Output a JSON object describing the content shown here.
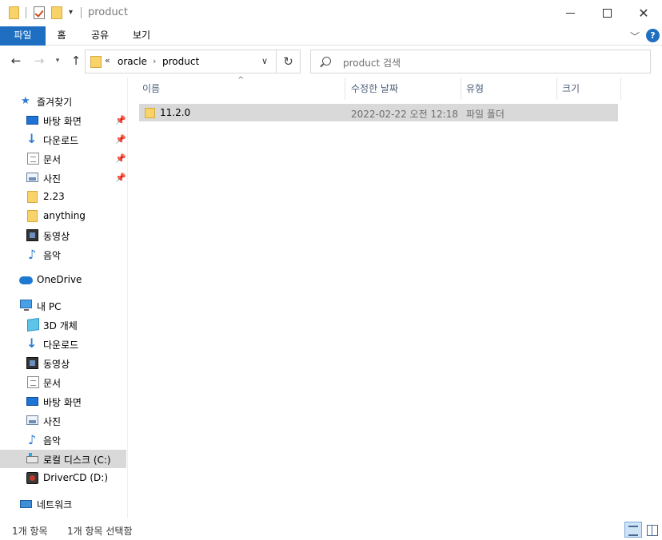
{
  "window": {
    "title": "product",
    "minimize_icon": "minimize-icon",
    "maximize_icon": "maximize-icon",
    "close_icon": "close-icon"
  },
  "ribbon": {
    "tabs": [
      {
        "label": "파일",
        "active": true
      },
      {
        "label": "홈"
      },
      {
        "label": "공유"
      },
      {
        "label": "보기"
      }
    ],
    "accent": "#1e6fc1"
  },
  "address": {
    "overflow": "«",
    "segments": [
      "oracle",
      "product"
    ]
  },
  "search": {
    "placeholder": "product 검색"
  },
  "nav": {
    "quick_access": "즐겨찾기",
    "pinned": [
      {
        "label": "바탕 화면",
        "icon": "desktop-icon"
      },
      {
        "label": "다운로드",
        "icon": "download-icon"
      },
      {
        "label": "문서",
        "icon": "document-icon"
      },
      {
        "label": "사진",
        "icon": "pictures-icon"
      }
    ],
    "recent": [
      {
        "label": "2.23",
        "icon": "folder-icon"
      },
      {
        "label": "anything",
        "icon": "folder-icon"
      },
      {
        "label": "동영상",
        "icon": "video-icon"
      },
      {
        "label": "음악",
        "icon": "music-icon"
      }
    ],
    "onedrive": "OneDrive",
    "this_pc": "내 PC",
    "pc_items": [
      {
        "label": "3D 개체",
        "icon": "3d-objects-icon"
      },
      {
        "label": "다운로드",
        "icon": "download-icon"
      },
      {
        "label": "동영상",
        "icon": "video-icon"
      },
      {
        "label": "문서",
        "icon": "document-icon"
      },
      {
        "label": "바탕 화면",
        "icon": "desktop-icon"
      },
      {
        "label": "사진",
        "icon": "pictures-icon"
      },
      {
        "label": "음악",
        "icon": "music-icon"
      },
      {
        "label": "로컬 디스크 (C:)",
        "icon": "drive-icon",
        "selected": true
      },
      {
        "label": "DriverCD (D:)",
        "icon": "dvd-drive-icon"
      }
    ],
    "network": "네트워크"
  },
  "columns": {
    "name": "이름",
    "date": "수정한 날짜",
    "type": "유형",
    "size": "크기"
  },
  "files": [
    {
      "name": "11.2.0",
      "date": "2022-02-22 오전 12:18",
      "type": "파일 폴더",
      "size": ""
    }
  ],
  "status": {
    "count": "1개 항목",
    "selected": "1개 항목 선택함"
  }
}
